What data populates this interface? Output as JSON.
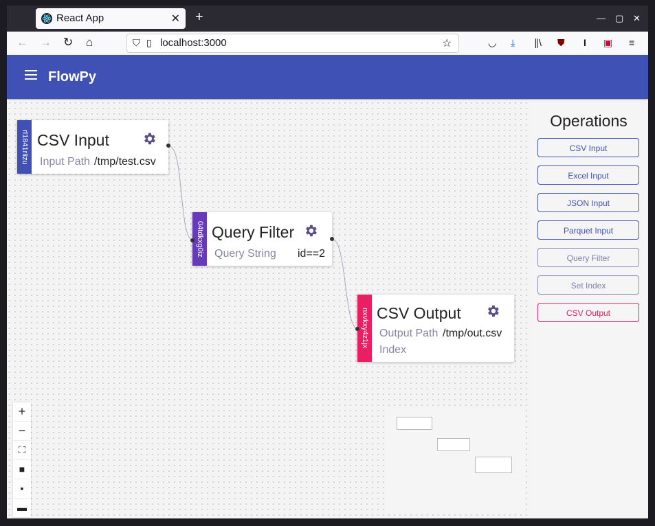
{
  "browser": {
    "tab_title": "React App",
    "url": "localhost:3000"
  },
  "app": {
    "title": "FlowPy"
  },
  "nodes": [
    {
      "id": "rl1841rlizu",
      "title": "CSV Input",
      "color": "#3f51b5",
      "params": [
        {
          "label": "Input Path",
          "value": "/tmp/test.csv"
        }
      ]
    },
    {
      "id": "04tdkxg0iz",
      "title": "Query Filter",
      "color": "#673ab7",
      "params": [
        {
          "label": "Query String",
          "value": "id==2"
        }
      ]
    },
    {
      "id": "nxvkxy4z1jx",
      "title": "CSV Output",
      "color": "#e91e63",
      "params": [
        {
          "label": "Output Path",
          "value": "/tmp/out.csv"
        },
        {
          "label": "Index",
          "value": ""
        }
      ]
    }
  ],
  "sidebar": {
    "title": "Operations",
    "operations": [
      {
        "label": "CSV Input",
        "color": "#3f51b5"
      },
      {
        "label": "Excel Input",
        "color": "#3f51b5"
      },
      {
        "label": "JSON Input",
        "color": "#3f51b5"
      },
      {
        "label": "Parquet Input",
        "color": "#3f51b5"
      },
      {
        "label": "Query Filter",
        "color": "#7f7fb0"
      },
      {
        "label": "Set Index",
        "color": "#7f7fb0"
      },
      {
        "label": "CSV Output",
        "color": "#e91e63"
      }
    ]
  },
  "controls": [
    "zoom-in-icon",
    "zoom-out-icon",
    "fit-view-icon",
    "lock-icon",
    "save-icon",
    "folder-icon"
  ]
}
